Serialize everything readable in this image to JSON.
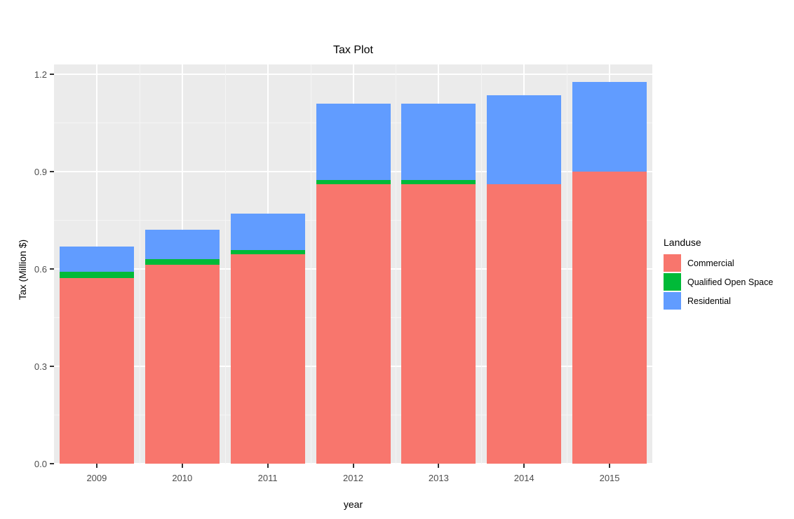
{
  "chart_data": {
    "type": "bar",
    "title": "Tax Plot",
    "xlabel": "year",
    "ylabel": "Tax (Million $)",
    "stacked": true,
    "grid": true,
    "legend_position": "right",
    "legend_title": "Landuse",
    "categories": [
      "2009",
      "2010",
      "2011",
      "2012",
      "2013",
      "2014",
      "2015"
    ],
    "ylim": [
      0.0,
      1.23
    ],
    "y_ticks": [
      "0.0",
      "0.3",
      "0.6",
      "0.9",
      "1.2"
    ],
    "y_tick_values": [
      0.0,
      0.3,
      0.6,
      0.9,
      1.2
    ],
    "series": [
      {
        "name": "Commercial",
        "color": "#F8766D",
        "values": [
          0.572,
          0.613,
          0.645,
          0.862,
          0.862,
          0.862,
          0.9
        ]
      },
      {
        "name": "Qualified Open Space",
        "color": "#00BA38",
        "values": [
          0.019,
          0.017,
          0.013,
          0.013,
          0.013,
          0.0,
          0.0
        ]
      },
      {
        "name": "Residential",
        "color": "#619CFF",
        "values": [
          0.079,
          0.09,
          0.112,
          0.235,
          0.235,
          0.273,
          0.277
        ]
      }
    ],
    "totals": [
      0.67,
      0.72,
      0.77,
      1.11,
      1.11,
      1.135,
      1.177
    ]
  },
  "legend": {
    "title": "Landuse",
    "entries": [
      {
        "label": "Commercial",
        "color": "#F8766D"
      },
      {
        "label": "Qualified Open Space",
        "color": "#00BA38"
      },
      {
        "label": "Residential",
        "color": "#619CFF"
      }
    ]
  }
}
